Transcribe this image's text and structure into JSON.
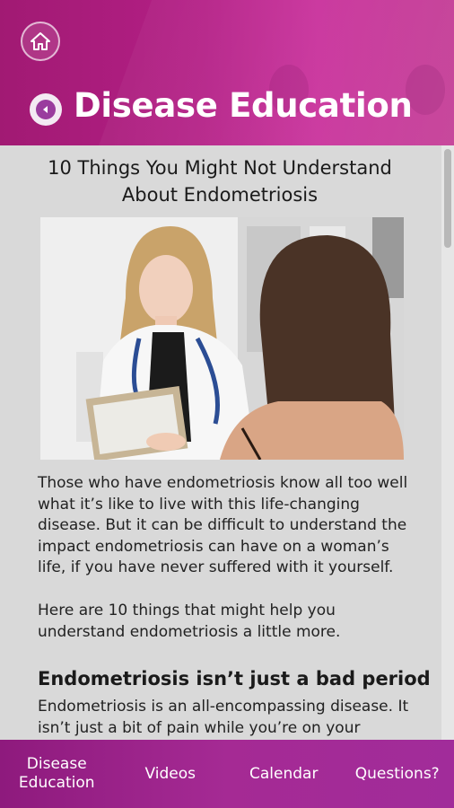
{
  "header": {
    "title": "Disease Education",
    "home_icon": "home-icon",
    "back_icon": "back-arrow-icon"
  },
  "article": {
    "title": "10 Things You Might Not Understand About Endometriosis",
    "image_alt": "doctor-with-patient-photo",
    "paragraph1": "Those who have endometriosis know all too well what it’s like to live with this life-changing disease. But it can be difficult to understand the impact endometriosis can have on a woman’s life, if you have never suffered with it yourself.",
    "paragraph2": "Here are 10 things that might help you understand endometriosis a little more.",
    "subheading": "Endometriosis isn’t just a bad period",
    "paragraph3": "Endometriosis is an all-encompassing disease. It isn’t just a bit of pain while you’re on your"
  },
  "bottom_nav": {
    "items": [
      {
        "label": "Disease\nEducation"
      },
      {
        "label": "Videos"
      },
      {
        "label": "Calendar"
      },
      {
        "label": "Questions?"
      }
    ]
  },
  "colors": {
    "header_primary": "#b41f86",
    "nav_primary": "#a52a94",
    "content_bg": "#d9d9d9"
  }
}
